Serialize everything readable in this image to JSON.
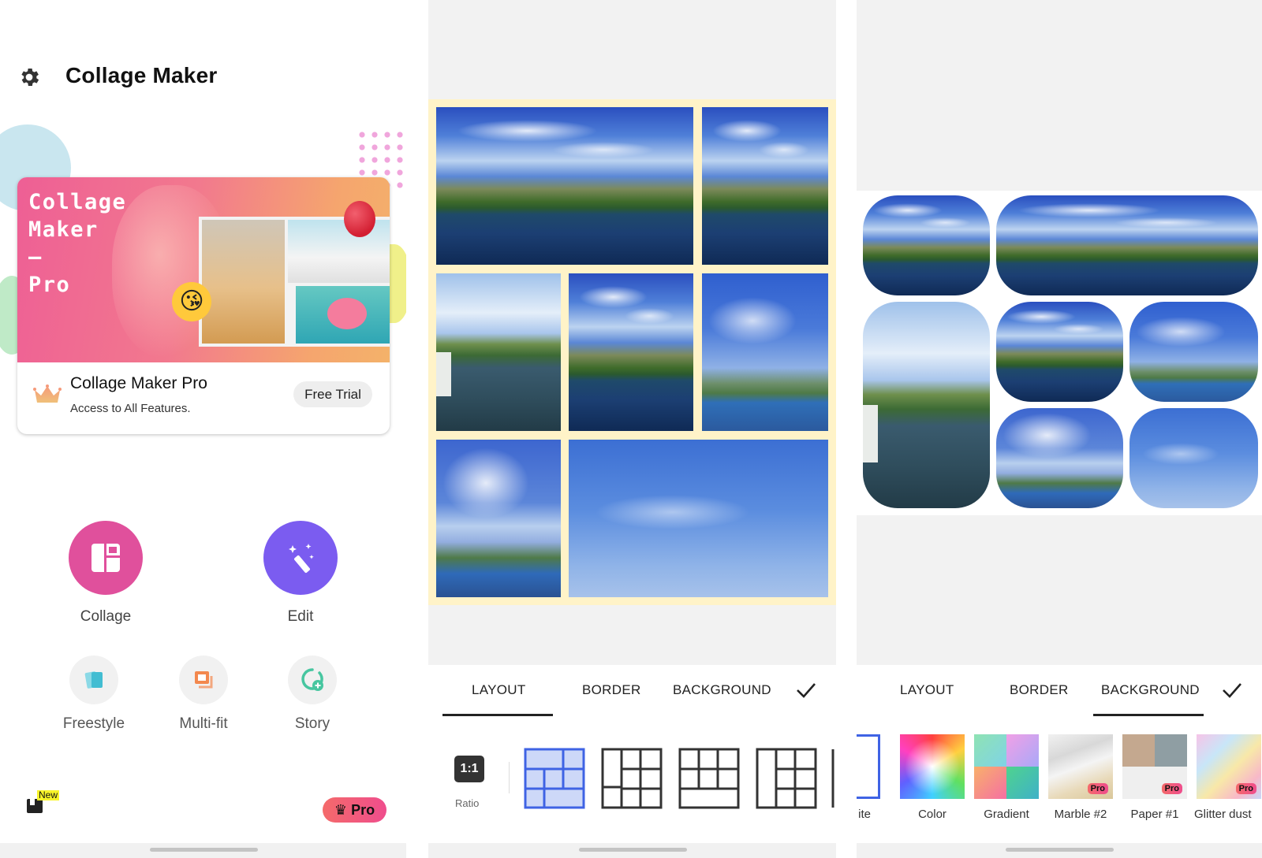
{
  "home": {
    "title": "Collage Maker",
    "promo": {
      "banner_title": "Collage\nMaker\n–\nPro",
      "name": "Collage Maker Pro",
      "subtitle": "Access to All Features.",
      "cta": "Free Trial"
    },
    "main_actions": [
      {
        "label": "Collage",
        "color": "#e0509c",
        "icon": "collage-icon"
      },
      {
        "label": "Edit",
        "color": "#7b5cf0",
        "icon": "magic-wand-icon"
      }
    ],
    "secondary_actions": [
      {
        "label": "Freestyle",
        "icon": "freestyle-icon",
        "color": "#5cc6d8"
      },
      {
        "label": "Multi-fit",
        "icon": "multi-fit-icon",
        "color": "#f3884e"
      },
      {
        "label": "Story",
        "icon": "story-icon",
        "color": "#47c6a0"
      }
    ],
    "new_badge": "New",
    "pro_button": "Pro"
  },
  "layout_editor": {
    "tabs": [
      "LAYOUT",
      "BORDER",
      "BACKGROUND"
    ],
    "active_tab": "LAYOUT",
    "ratio_value": "1:1",
    "ratio_label": "Ratio",
    "accent": "#3f63e4",
    "frame_color": "#fff3c8"
  },
  "background_editor": {
    "tabs": [
      "LAYOUT",
      "BORDER",
      "BACKGROUND"
    ],
    "active_tab": "BACKGROUND",
    "swatches": [
      {
        "label": "ite",
        "pro": false
      },
      {
        "label": "Color",
        "pro": false
      },
      {
        "label": "Gradient",
        "pro": false
      },
      {
        "label": "Marble #2",
        "pro": true
      },
      {
        "label": "Paper #1",
        "pro": true
      },
      {
        "label": "Glitter dust",
        "pro": true
      }
    ],
    "pro_chip": "Pro"
  }
}
